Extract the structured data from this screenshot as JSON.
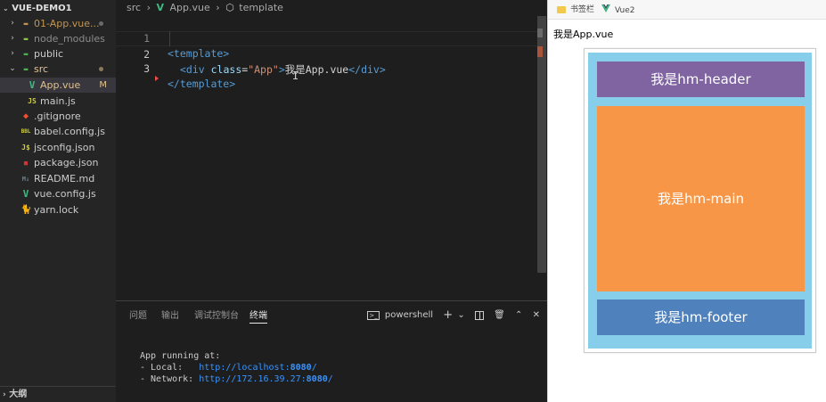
{
  "explorer": {
    "project": "VUE-DEMO1",
    "items": [
      {
        "name": "01-App.vue...",
        "kind": "folder",
        "color": "#c09553",
        "icon": "folder-icon"
      },
      {
        "name": "node_modules",
        "kind": "folder",
        "color": "#8c8c8c",
        "icon": "folder-node-icon"
      },
      {
        "name": "public",
        "kind": "folder",
        "color": "#cccccc",
        "icon": "folder-public-icon"
      },
      {
        "name": "src",
        "kind": "folder-open",
        "color": "#e2c08d",
        "icon": "folder-src-icon"
      },
      {
        "name": "App.vue",
        "kind": "file",
        "color": "#e2c08d",
        "icon": "vue-icon",
        "badge": "M"
      },
      {
        "name": "main.js",
        "kind": "file",
        "color": "#cccccc",
        "icon": "js-icon"
      },
      {
        "name": ".gitignore",
        "kind": "file",
        "color": "#cccccc",
        "icon": "git-icon"
      },
      {
        "name": "babel.config.js",
        "kind": "file",
        "color": "#cccccc",
        "icon": "babel-icon"
      },
      {
        "name": "jsconfig.json",
        "kind": "file",
        "color": "#cccccc",
        "icon": "json-icon"
      },
      {
        "name": "package.json",
        "kind": "file",
        "color": "#cccccc",
        "icon": "npm-icon"
      },
      {
        "name": "README.md",
        "kind": "file",
        "color": "#cccccc",
        "icon": "markdown-icon"
      },
      {
        "name": "vue.config.js",
        "kind": "file",
        "color": "#cccccc",
        "icon": "vue-config-icon"
      },
      {
        "name": "yarn.lock",
        "kind": "file",
        "color": "#cccccc",
        "icon": "yarn-icon"
      }
    ],
    "outline": "大纲"
  },
  "breadcrumb": {
    "folder": "src",
    "file": "App.vue",
    "symbol": "template"
  },
  "code": {
    "line_numbers": [
      "1",
      "2",
      "3"
    ],
    "line1_tag": "<template>",
    "line2_open": "<div ",
    "line2_attr": "class",
    "line2_eq": "=",
    "line2_val": "\"App\"",
    "line2_gt": ">",
    "line2_text": "我是App.vue",
    "line2_close": "</div>",
    "line3_tag": "</template>"
  },
  "panel": {
    "tabs": [
      "问题",
      "输出",
      "调试控制台",
      "终端"
    ],
    "active_tab": "终端",
    "shell": "powershell",
    "terminal": {
      "line1": "App running at:",
      "local_label": "- Local:   ",
      "local_url_prefix": "http://localhost:",
      "local_port": "8080",
      "local_suffix": "/",
      "network_label": "- Network: ",
      "network_url_prefix": "http://172.16.39.27:",
      "network_port": "8080",
      "network_suffix": "/"
    }
  },
  "browser": {
    "bookmarks": [
      "书签栏",
      "Vue2"
    ],
    "page_text": "我是App.vue",
    "header": "我是hm-header",
    "main": "我是hm-main",
    "footer": "我是hm-footer",
    "colors": {
      "container": "#87ceeb",
      "header": "#8064a2",
      "main": "#f79646",
      "footer": "#4f81bd"
    }
  }
}
